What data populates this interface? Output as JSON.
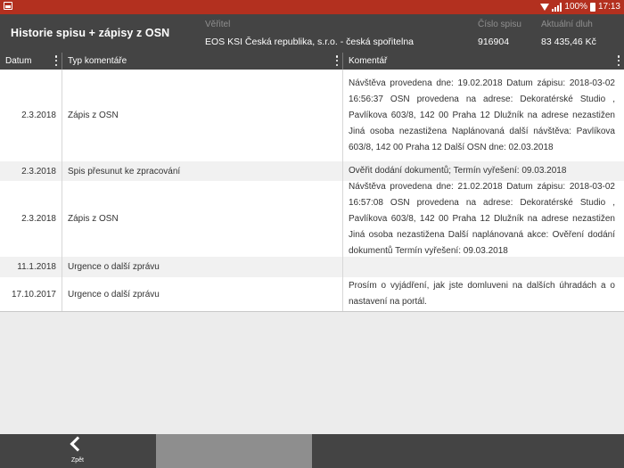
{
  "statusbar": {
    "battery": "100%",
    "time": "17:13"
  },
  "header": {
    "title": "Historie spisu + zápisy z OSN",
    "veritel_label": "Věřitel",
    "veritel_value": "EOS KSI Česká republika, s.r.o. - česká spořitelna",
    "cislo_label": "Číslo spisu",
    "cislo_value": "916904",
    "dluh_label": "Aktuální dluh",
    "dluh_value": "83 435,46 Kč"
  },
  "table": {
    "columns": [
      "Datum",
      "Typ komentáře",
      "Komentář"
    ],
    "rows": [
      {
        "date": "2.3.2018",
        "type": "Zápis z OSN",
        "comment": "Návštěva provedena dne: 19.02.2018 Datum zápisu: 2018-03-02 16:56:37 OSN provedena na adrese: Dekoratérské Studio , Pavlíkova 603/8, 142 00 Praha 12 Dlužník na adrese nezastižen Jiná osoba nezastižena Naplánovaná další návštěva: Pavlíkova 603/8, 142 00 Praha 12 Další OSN dne: 02.03.2018"
      },
      {
        "date": "2.3.2018",
        "type": "Spis přesunut ke zpracování",
        "comment": "Ověřit dodání dokumentů; Termín vyřešení: 09.03.2018"
      },
      {
        "date": "2.3.2018",
        "type": "Zápis z OSN",
        "comment": "Návštěva provedena dne: 21.02.2018 Datum zápisu: 2018-03-02 16:57:08 OSN provedena na adrese: Dekoratérské Studio , Pavlíkova 603/8, 142 00 Praha 12 Dlužník na adrese nezastižen Jiná osoba nezastižena Další naplánovaná akce: Ověření dodání dokumentů Termín vyřešení: 09.03.2018"
      },
      {
        "date": "11.1.2018",
        "type": "Urgence o další zprávu",
        "comment": ""
      },
      {
        "date": "17.10.2017",
        "type": "Urgence o další zprávu",
        "comment": "Prosím o vyjádření, jak jste domluveni na dalších úhradách a o nastavení na portál."
      }
    ]
  },
  "bottombar": {
    "back_label": "Zpět"
  }
}
